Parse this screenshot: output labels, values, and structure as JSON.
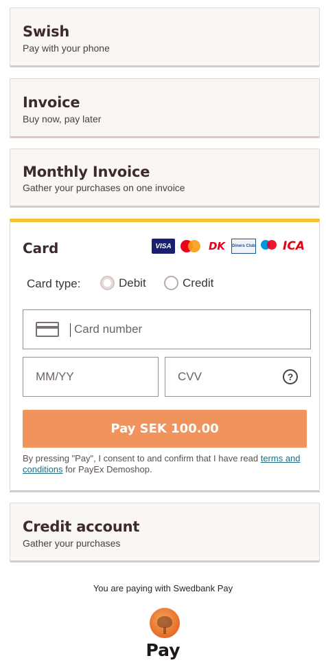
{
  "methods": {
    "swish": {
      "title": "Swish",
      "subtitle": "Pay with your phone"
    },
    "invoice": {
      "title": "Invoice",
      "subtitle": "Buy now, pay later"
    },
    "monthly": {
      "title": "Monthly Invoice",
      "subtitle": "Gather your purchases on one invoice"
    },
    "credit_account": {
      "title": "Credit account",
      "subtitle": "Gather your purchases"
    }
  },
  "card": {
    "title": "Card",
    "logos": [
      "VISA",
      "Mastercard",
      "DK",
      "Diners Club International",
      "Maestro",
      "ICA"
    ],
    "card_type_label": "Card type:",
    "options": {
      "debit": "Debit",
      "credit": "Credit"
    },
    "selected_type": "Debit",
    "card_number_placeholder": "Card number",
    "expiry_placeholder": "MM/YY",
    "cvv_placeholder": "CVV",
    "cvv_help": "?",
    "pay_label": "Pay SEK 100.00",
    "consent_before": "By pressing \"Pay\", I consent to and confirm that I have read ",
    "consent_link": "terms and conditions",
    "consent_after": " for PayEx Demoshop."
  },
  "footer": {
    "text": "You are paying with Swedbank Pay",
    "pay_word": "Pay"
  },
  "colors": {
    "accent_top": "#f5c132",
    "pay_button": "#f0935d",
    "link": "#1a6e85"
  }
}
